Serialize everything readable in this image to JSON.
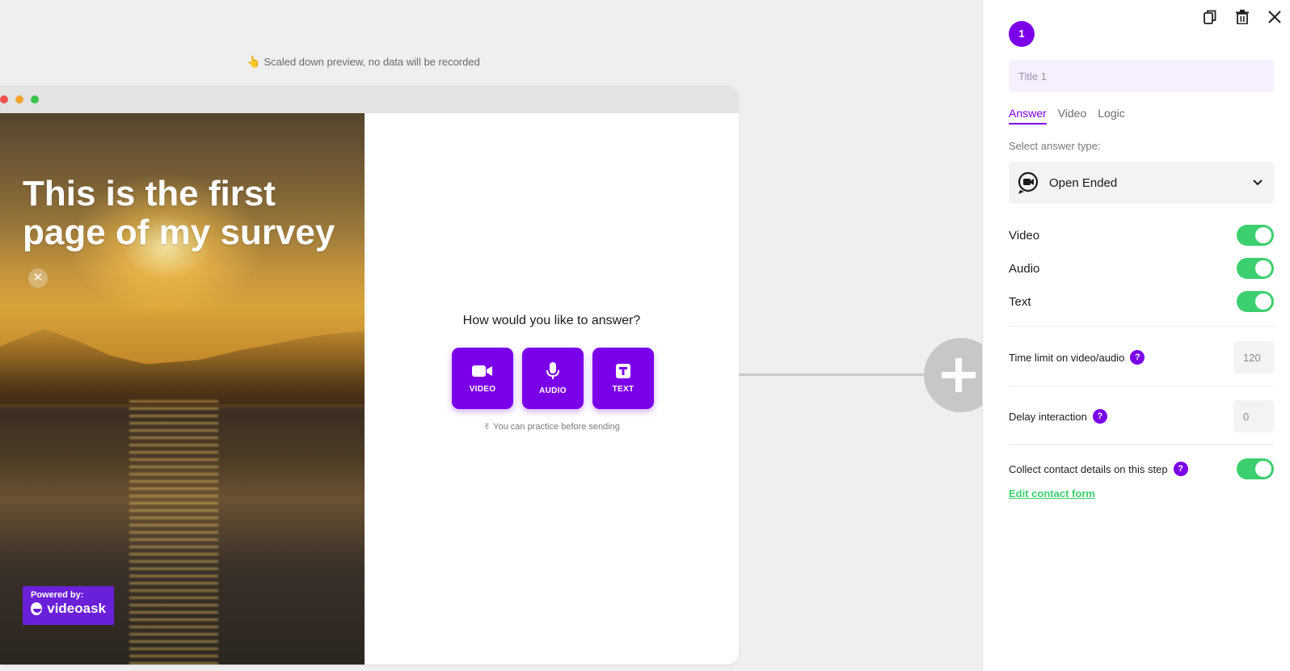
{
  "preview": {
    "notice": "Scaled down preview, no data will be recorded",
    "media_title": "This is the first page of my survey",
    "powered_by": "Powered by:",
    "brand": "videoask",
    "question": "How would you like to answer?",
    "buttons": [
      {
        "label": "VIDEO",
        "icon": "video-camera-icon"
      },
      {
        "label": "AUDIO",
        "icon": "microphone-icon"
      },
      {
        "label": "TEXT",
        "icon": "text-icon"
      }
    ],
    "practice_note": "You can practice before sending"
  },
  "panel": {
    "step_number": "1",
    "title_placeholder": "Title 1",
    "tabs": [
      {
        "label": "Answer",
        "active": true
      },
      {
        "label": "Video",
        "active": false
      },
      {
        "label": "Logic",
        "active": false
      }
    ],
    "answer_type_label": "Select answer type:",
    "answer_type_value": "Open Ended",
    "toggles": [
      {
        "label": "Video",
        "on": true
      },
      {
        "label": "Audio",
        "on": true
      },
      {
        "label": "Text",
        "on": true
      }
    ],
    "time_limit_label": "Time limit on video/audio",
    "time_limit_value": "120",
    "delay_label": "Delay interaction",
    "delay_value": "0",
    "contact_label": "Collect contact details on this step",
    "contact_on": true,
    "edit_contact_link": "Edit contact form",
    "help_glyph": "?"
  },
  "colors": {
    "accent": "#7b00ea",
    "toggle_on": "#3ccf6e",
    "brand_purple": "#6a1fd8"
  }
}
